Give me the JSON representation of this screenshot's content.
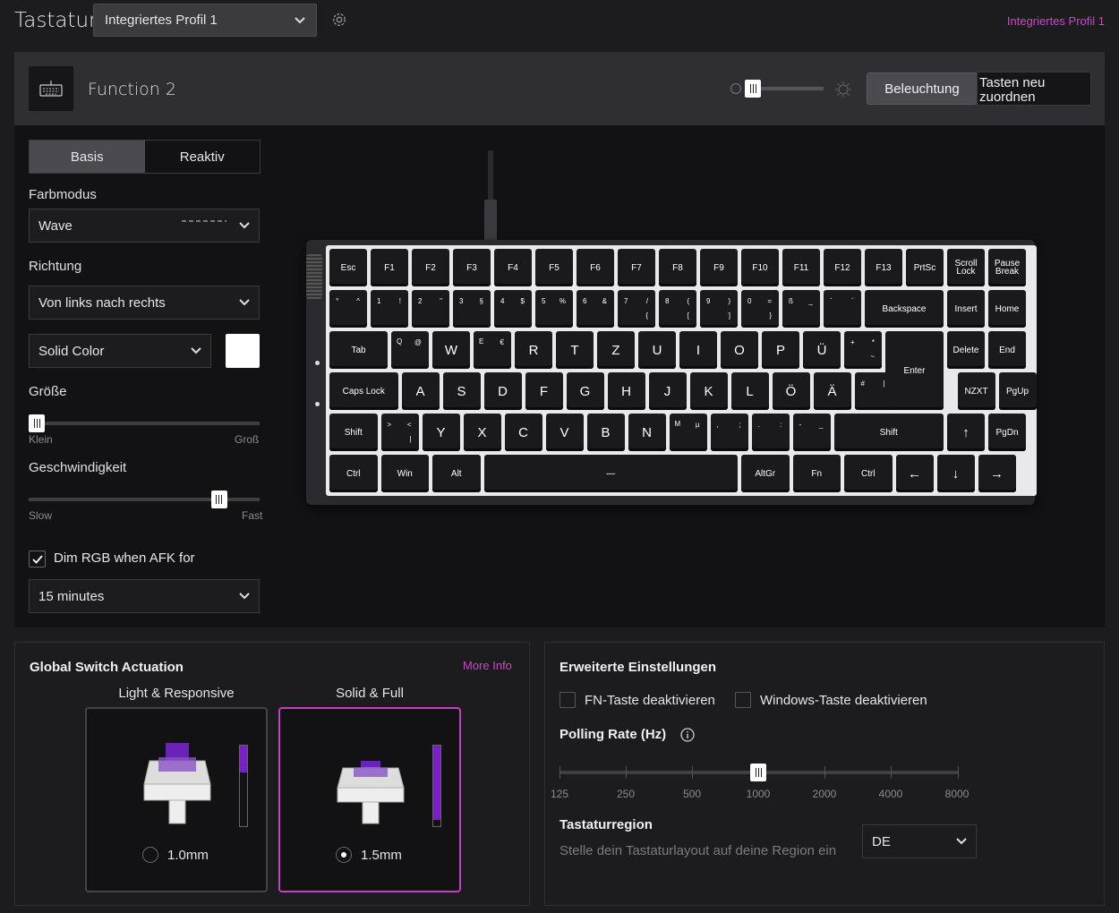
{
  "header": {
    "title": "Tastatur",
    "profile_select": "Integriertes Profil 1",
    "profile_tag": "Integriertes Profil 1"
  },
  "panel": {
    "layer_name": "Function 2",
    "lighting_button": "Beleuchtung",
    "remap_button": "Tasten neu zuordnen"
  },
  "left": {
    "tabs": [
      "Basis",
      "Reaktiv"
    ],
    "color_mode_label": "Farbmodus",
    "color_mode_value": "Wave",
    "direction_label": "Richtung",
    "direction_value": "Von links nach rechts",
    "color_type_value": "Solid Color",
    "color_swatch": "#ffffff",
    "size_label": "Größe",
    "size_min": "Klein",
    "size_max": "Groß",
    "size_value": 0,
    "speed_label": "Geschwindigkeit",
    "speed_min": "Slow",
    "speed_max": "Fast",
    "speed_value": 0.79,
    "afk_label": "Dim RGB when AFK for",
    "afk_checked": true,
    "afk_value": "15 minutes"
  },
  "keyboard": {
    "row1": [
      "Esc",
      "F1",
      "F2",
      "F3",
      "F4",
      "F5",
      "F6",
      "F7",
      "F8",
      "F9",
      "F10",
      "F11",
      "F12",
      "F13",
      "PrtSc",
      "Scroll\nLock",
      "Pause\nBreak"
    ],
    "row2": [
      [
        "°",
        "^"
      ],
      [
        "1",
        "!"
      ],
      [
        "2",
        "\""
      ],
      [
        "3",
        "§"
      ],
      [
        "4",
        "$"
      ],
      [
        "5",
        "%"
      ],
      [
        "6",
        "&"
      ],
      [
        "7",
        "/",
        "{"
      ],
      [
        "8",
        "(",
        "["
      ],
      [
        "9",
        ")",
        "]"
      ],
      [
        "0",
        "=",
        "}"
      ],
      [
        "ß",
        "_"
      ],
      [
        "`",
        "´"
      ],
      "Backspace",
      "Insert",
      "Home"
    ],
    "row3": [
      "Tab",
      [
        "Q",
        "@"
      ],
      "W",
      [
        "E",
        "€"
      ],
      "R",
      "T",
      "Z",
      "U",
      "I",
      "O",
      "P",
      "Ü",
      [
        "+",
        "*",
        "~"
      ],
      "Enter",
      "Delete",
      "End"
    ],
    "row4": [
      "Caps Lock",
      "A",
      "S",
      "D",
      "F",
      "G",
      "H",
      "J",
      "K",
      "L",
      "Ö",
      "Ä",
      [
        "#",
        "|"
      ],
      "NZXT",
      "PgUp"
    ],
    "row5": [
      "Shift",
      [
        ">",
        "<",
        "|"
      ],
      "Y",
      "X",
      "C",
      "V",
      "B",
      "N",
      [
        "M",
        "µ"
      ],
      [
        ",",
        ";"
      ],
      [
        ".",
        ":"
      ],
      [
        "-",
        "_"
      ],
      "Shift",
      "↑",
      "PgDn"
    ],
    "row6": [
      "Ctrl",
      "Win",
      "Alt",
      "—",
      "AltGr",
      "Fn",
      "Ctrl",
      "←",
      "↓",
      "→"
    ]
  },
  "actuation": {
    "title": "Global Switch Actuation",
    "more_info": "More Info",
    "options": [
      {
        "title": "Light & Responsive",
        "value": "1.0mm",
        "selected": false,
        "level": 0.33
      },
      {
        "title": "Solid & Full",
        "value": "1.5mm",
        "selected": true,
        "level": 0.92
      }
    ]
  },
  "advanced": {
    "title": "Erweiterte Einstellungen",
    "fn_disable": "FN-Taste deaktivieren",
    "win_disable": "Windows-Taste deaktivieren",
    "polling_label": "Polling Rate (Hz)",
    "polling_values": [
      "125",
      "250",
      "500",
      "1000",
      "2000",
      "4000",
      "8000"
    ],
    "polling_selected": "1000",
    "region_label": "Tastaturregion",
    "region_desc": "Stelle dein Tastaturlayout auf deine Region ein",
    "region_value": "DE"
  }
}
